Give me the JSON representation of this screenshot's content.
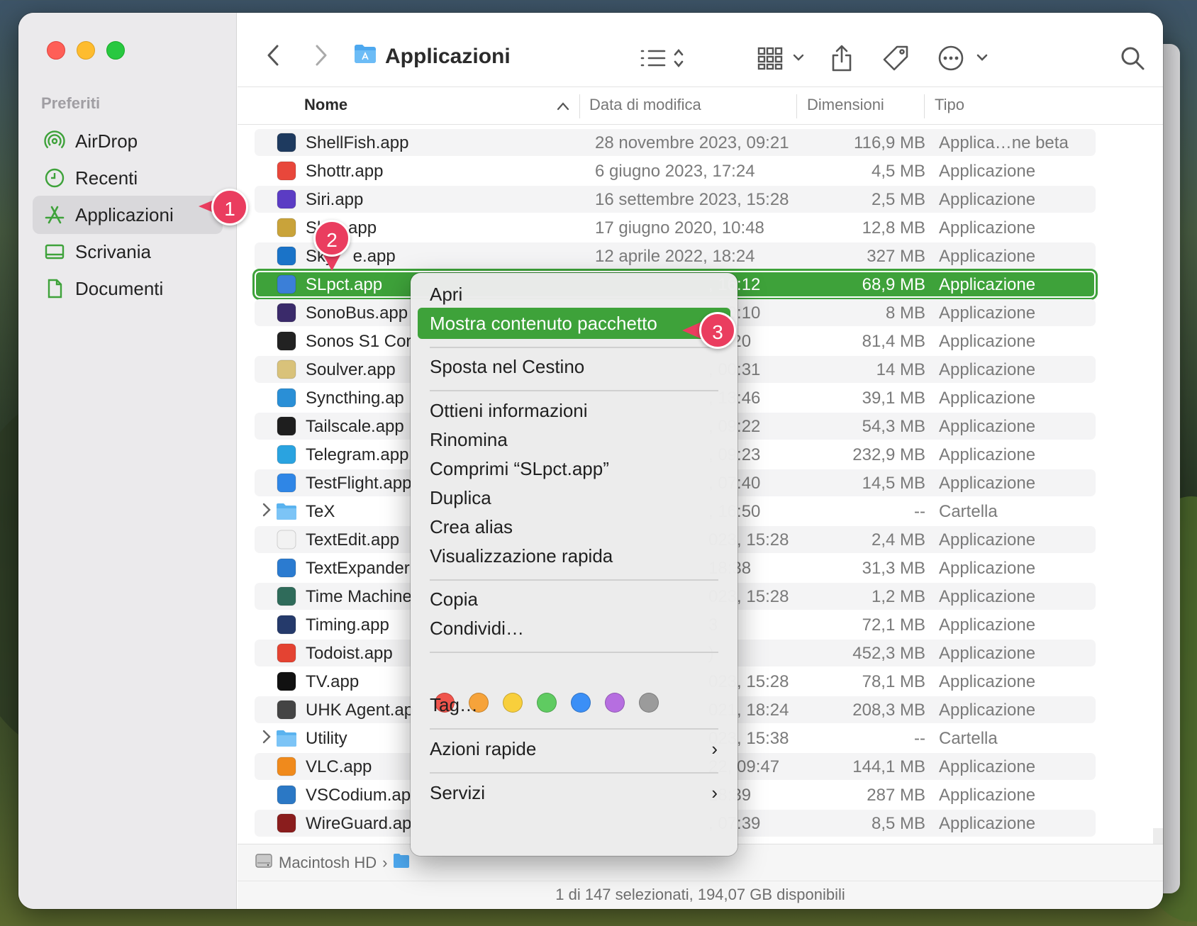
{
  "sidebar": {
    "section_title": "Preferiti",
    "items": [
      {
        "label": "AirDrop",
        "icon": "airdrop-icon"
      },
      {
        "label": "Recenti",
        "icon": "clock-icon"
      },
      {
        "label": "Applicazioni",
        "icon": "applications-icon",
        "selected": true
      },
      {
        "label": "Scrivania",
        "icon": "desktop-icon"
      },
      {
        "label": "Documenti",
        "icon": "document-icon"
      }
    ]
  },
  "toolbar": {
    "title": "Applicazioni",
    "icons": [
      "back-icon",
      "forward-icon",
      "folder-icon",
      "list-view-icon",
      "grid-view-icon",
      "share-icon",
      "tag-icon",
      "more-icon",
      "search-icon"
    ]
  },
  "columns": {
    "name": "Nome",
    "date": "Data di modifica",
    "size": "Dimensioni",
    "type": "Tipo"
  },
  "rows": [
    {
      "name": "ShellFish.app",
      "date": "28 novembre 2023, 09:21",
      "size": "116,9 MB",
      "type": "Applica…ne beta",
      "icon_color": "#1e3a5f"
    },
    {
      "name": "Shottr.app",
      "date": "6 giugno 2023, 17:24",
      "size": "4,5 MB",
      "type": "Applicazione",
      "icon_color": "#e8473b"
    },
    {
      "name": "Siri.app",
      "date": "16 settembre 2023, 15:28",
      "size": "2,5 MB",
      "type": "Applicazione",
      "icon_color": "#5b3cc4"
    },
    {
      "name": "Ski",
      "name_tail": "app",
      "date": "17 giugno 2020, 10:48",
      "size": "12,8 MB",
      "type": "Applicazione",
      "icon_color": "#c9a33a"
    },
    {
      "name": "Sky",
      "name_tail": "e.app",
      "date": "12 aprile 2022, 18:24",
      "size": "327 MB",
      "type": "Applicazione",
      "icon_color": "#1a73c8"
    },
    {
      "name": "SLpct.app",
      "date": ", 16:12",
      "size": "68,9 MB",
      "type": "Applicazione",
      "icon_color": "#3b7fd8",
      "selected": true
    },
    {
      "name": "SonoBus.app",
      "date": ", 20:10",
      "size": "8 MB",
      "type": "Applicazione",
      "icon_color": "#3a2a6a"
    },
    {
      "name": "Sonos S1 Cor",
      "date": "18:20",
      "size": "81,4 MB",
      "type": "Applicazione",
      "icon_color": "#222"
    },
    {
      "name": "Soulver.app",
      "date": ", 00:31",
      "size": "14 MB",
      "type": "Applicazione",
      "icon_color": "#d9c27a"
    },
    {
      "name": "Syncthing.ap",
      "date": ", 13:46",
      "size": "39,1 MB",
      "type": "Applicazione",
      "icon_color": "#2a8fd6"
    },
    {
      "name": "Tailscale.app",
      "date": ", 09:22",
      "size": "54,3 MB",
      "type": "Applicazione",
      "icon_color": "#1e1e1e"
    },
    {
      "name": "Telegram.app",
      "date": ", 09:23",
      "size": "232,9 MB",
      "type": "Applicazione",
      "icon_color": "#2aa3e0"
    },
    {
      "name": "TestFlight.app",
      "date": ", 07:40",
      "size": "14,5 MB",
      "type": "Applicazione",
      "icon_color": "#2f86e6"
    },
    {
      "name": "TeX",
      "date": ", 16:50",
      "size": "--",
      "type": "Cartella",
      "icon_color": "#5ab3ef",
      "folder": true
    },
    {
      "name": "TextEdit.app",
      "date": "023, 15:28",
      "size": "2,4 MB",
      "type": "Applicazione",
      "icon_color": "#f2f2f2"
    },
    {
      "name": "TextExpander",
      "date": "18:38",
      "size": "31,3 MB",
      "type": "Applicazione",
      "icon_color": "#2b7bd0"
    },
    {
      "name": "Time Machine",
      "date": "023, 15:28",
      "size": "1,2 MB",
      "type": "Applicazione",
      "icon_color": "#2f6b5a"
    },
    {
      "name": "Timing.app",
      "date": "3",
      "size": "72,1 MB",
      "type": "Applicazione",
      "icon_color": "#253a6b"
    },
    {
      "name": "Todoist.app",
      "date": ")",
      "size": "452,3 MB",
      "type": "Applicazione",
      "icon_color": "#e44332"
    },
    {
      "name": "TV.app",
      "date": "023, 15:28",
      "size": "78,1 MB",
      "type": "Applicazione",
      "icon_color": "#111"
    },
    {
      "name": "UHK Agent.ap",
      "date": "021, 18:24",
      "size": "208,3 MB",
      "type": "Applicazione",
      "icon_color": "#444"
    },
    {
      "name": "Utility",
      "date": "023, 15:38",
      "size": "--",
      "type": "Cartella",
      "icon_color": "#5ab3ef",
      "folder": true
    },
    {
      "name": "VLC.app",
      "date": "22, 09:47",
      "size": "144,1 MB",
      "type": "Applicazione",
      "icon_color": "#f08a1c"
    },
    {
      "name": "VSCodium.ap",
      "date": "18:39",
      "size": "287 MB",
      "type": "Applicazione",
      "icon_color": "#2b78c5"
    },
    {
      "name": "WireGuard.ap",
      "date": ", 07:39",
      "size": "8,5 MB",
      "type": "Applicazione",
      "icon_color": "#8a1d1d"
    }
  ],
  "pathbar": {
    "disk": "Macintosh HD",
    "separator": "›"
  },
  "status": "1 di 147 selezionati, 194,07 GB disponibili",
  "context_menu": {
    "items": [
      {
        "label": "Apri"
      },
      {
        "label": "Mostra contenuto pacchetto",
        "highlighted": true
      },
      {
        "label": "Sposta nel Cestino"
      },
      {
        "label": "Ottieni informazioni"
      },
      {
        "label": "Rinomina"
      },
      {
        "label": "Comprimi “SLpct.app”"
      },
      {
        "label": "Duplica"
      },
      {
        "label": "Crea alias"
      },
      {
        "label": "Visualizzazione rapida"
      },
      {
        "label": "Copia"
      },
      {
        "label": "Condividi…"
      },
      {
        "label": "Tag…"
      },
      {
        "label": "Azioni rapide",
        "submenu": true
      },
      {
        "label": "Servizi",
        "submenu": true
      }
    ],
    "tag_colors": [
      "#f0544c",
      "#f6a33a",
      "#f8cf3c",
      "#5fcb61",
      "#3b8ff6",
      "#b66ee0",
      "#9b9b9b"
    ],
    "submenu_arrow": "›"
  },
  "badges": [
    "1",
    "2",
    "3"
  ],
  "accent_color": "#3ea23a",
  "badge_color": "#ea3d5f"
}
